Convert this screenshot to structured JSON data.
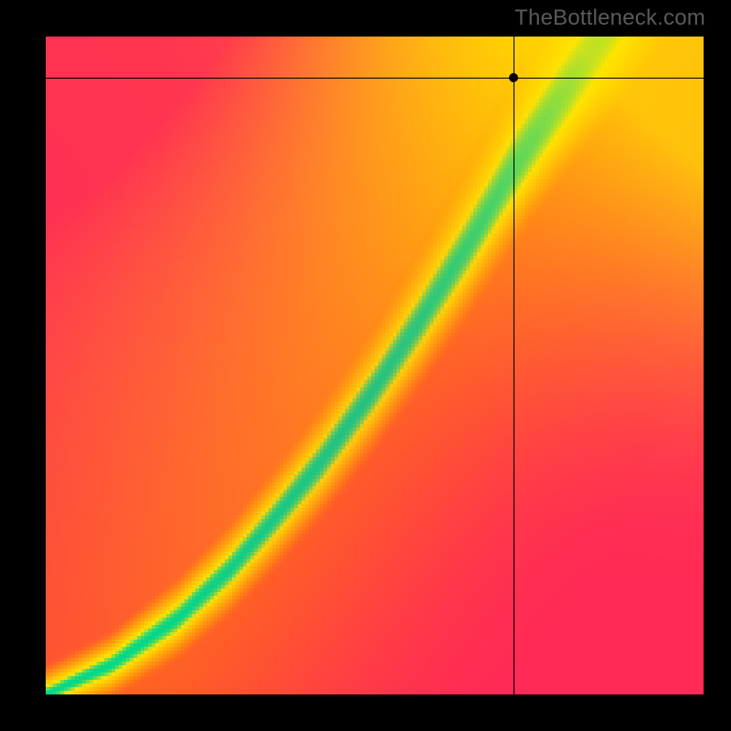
{
  "watermark": {
    "text": "TheBottleneck.com"
  },
  "crosshair": {
    "x_ratio": 0.711,
    "y_ratio": 0.062
  },
  "canvas": {
    "size": 180,
    "display": 720
  },
  "colors": {
    "red": "#ff2a55",
    "orange": "#ff8a00",
    "yellow": "#ffe500",
    "green": "#00d88a",
    "black": "#000000"
  },
  "chart_data": {
    "type": "heatmap",
    "title": "",
    "xlabel": "",
    "ylabel": "",
    "xlim": [
      0,
      1
    ],
    "ylim": [
      0,
      1
    ],
    "note": "Color encodes bottleneck score over a normalized 2D field. Green = balanced (ridge), yellow→orange→red = increasing bottleneck in either direction.",
    "ridge_band_halfwidth": 0.042,
    "soft_band_halfwidth": 0.12,
    "ridge": [
      {
        "x": 0.0,
        "y": 0.0
      },
      {
        "x": 0.1,
        "y": 0.045
      },
      {
        "x": 0.2,
        "y": 0.115
      },
      {
        "x": 0.28,
        "y": 0.19
      },
      {
        "x": 0.35,
        "y": 0.27
      },
      {
        "x": 0.42,
        "y": 0.355
      },
      {
        "x": 0.5,
        "y": 0.465
      },
      {
        "x": 0.57,
        "y": 0.57
      },
      {
        "x": 0.64,
        "y": 0.68
      },
      {
        "x": 0.705,
        "y": 0.79
      },
      {
        "x": 0.77,
        "y": 0.89
      },
      {
        "x": 0.835,
        "y": 0.985
      }
    ],
    "corner_colors": {
      "top_left": "red",
      "top_right": "yellow",
      "bottom_left": "red",
      "bottom_right": "red"
    },
    "marker": {
      "x": 0.711,
      "y": 0.938,
      "label": ""
    },
    "series": [],
    "categories": []
  }
}
